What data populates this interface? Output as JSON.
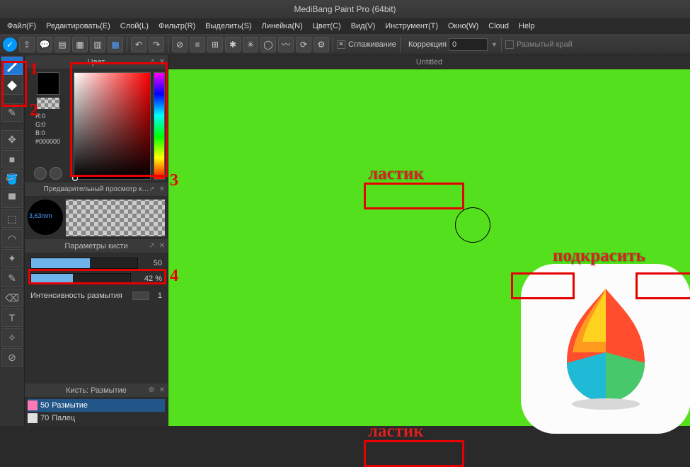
{
  "app": {
    "title": "MediBang Paint Pro (64bit)"
  },
  "menu": [
    "Файл(F)",
    "Редактировать(E)",
    "Слой(L)",
    "Фильтр(R)",
    "Выделить(S)",
    "Линейка(N)",
    "Цвет(C)",
    "Вид(V)",
    "Инструмент(T)",
    "Окно(W)",
    "Cloud",
    "Help"
  ],
  "toolbar": {
    "smoothing_label": "Сглаживание",
    "correction_label": "Коррекция",
    "correction_value": "0",
    "blurred_edge": "Размытый край"
  },
  "panels": {
    "color": {
      "title": "Цвет",
      "r": "R:0",
      "g": "G:0",
      "b": "B:0",
      "hex": "#000000"
    },
    "preview": {
      "title": "Предварительный просмотр к…",
      "size": "3,63mm"
    },
    "params": {
      "title": "Параметры кисти",
      "size_val": "50",
      "opacity_val": "42 %",
      "blur_label": "Интенсивность размытия",
      "blur_val": "1"
    },
    "brush": {
      "title": "Кисть: Размытие",
      "items": [
        {
          "size": "50",
          "name": "Размытие",
          "color": "#ff7ab5"
        },
        {
          "size": "70",
          "name": "Палец",
          "color": "#e0e0e0"
        }
      ]
    }
  },
  "tab": "Untitled",
  "annotations": {
    "eraser": "ластик",
    "touchup": "подкрасить",
    "n1": "1",
    "n2": "2",
    "n3": "3",
    "n4": "4"
  }
}
